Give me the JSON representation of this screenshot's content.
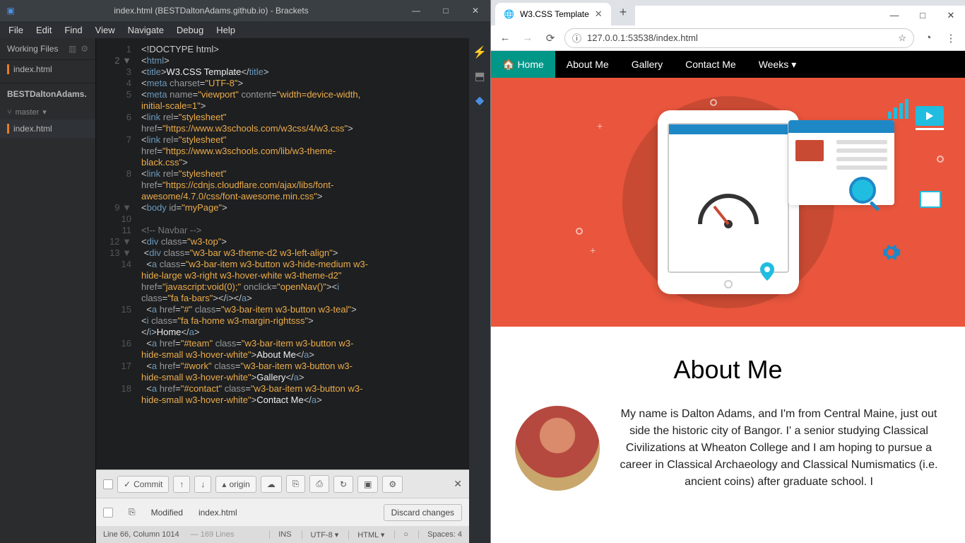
{
  "brackets": {
    "title": "index.html (BESTDaltonAdams.github.io) - Brackets",
    "menu": [
      "File",
      "Edit",
      "Find",
      "View",
      "Navigate",
      "Debug",
      "Help"
    ],
    "workingFiles": {
      "label": "Working Files",
      "items": [
        "index.html"
      ]
    },
    "project": {
      "name": "BESTDaltonAdams.",
      "branch": "master",
      "files": [
        "index.html"
      ]
    },
    "git": {
      "commit": "Commit",
      "origin": "origin",
      "modified": "Modified",
      "file": "index.html",
      "discard": "Discard changes"
    },
    "status": {
      "pos": "Line 66, Column 1014",
      "lines": "169 Lines",
      "ins": "INS",
      "enc": "UTF-8",
      "lang": "HTML",
      "spaces": "Spaces: 4"
    },
    "code": {
      "doctype": "<!DOCTYPE html>",
      "title_text": "W3.CSS Template",
      "charset": "UTF-8",
      "viewport": "width=device-width, initial-scale=1",
      "css1": "https://www.w3schools.com/w3css/4/w3.css",
      "css2": "https://www.w3schools.com/lib/w3-theme-black.css",
      "css3": "https://cdnjs.cloudflare.com/ajax/libs/font-awesome/4.7.0/css/font-awesome.min.css",
      "bodyid": "myPage",
      "comment": "<!-- Navbar -->",
      "cls_top": "w3-top",
      "cls_bar": "w3-bar w3-theme-d2 w3-left-align",
      "a1_class": "w3-bar-item w3-button w3-hide-medium w3-hide-large w3-right w3-hover-white w3-theme-d2",
      "a1_href": "javascript:void(0);",
      "a1_onclick": "openNav()",
      "a1_iclass": "fa fa-bars",
      "a2_href": "#",
      "a2_class": "w3-bar-item w3-button w3-teal",
      "a2_iclass": "fa fa-home w3-margin-rightsss",
      "a2_text": "Home",
      "a3_href": "#team",
      "a3_class": "w3-bar-item w3-button w3-hide-small w3-hover-white",
      "a3_text": "About Me",
      "a4_href": "#work",
      "a4_class": "w3-bar-item w3-button w3-hide-small w3-hover-white",
      "a4_text": "Gallery",
      "a5_href": "#contact",
      "a5_class": "w3-bar-item w3-button w3-hide-small w3-hover-white",
      "a5_text": "Contact Me"
    }
  },
  "browser": {
    "tabTitle": "W3.CSS Template",
    "url": "127.0.0.1:53538/index.html",
    "nav": {
      "home": "Home",
      "about": "About Me",
      "gallery": "Gallery",
      "contact": "Contact Me",
      "weeks": "Weeks"
    },
    "about": {
      "heading": "About Me",
      "text": "My name is Dalton Adams, and I'm from Central Maine, just out side the historic city of Bangor. I' a senior studying Classical Civilizations at Wheaton College and I am hoping to pursue a career in Classical Archaeology and Classical Numismatics (i.e. ancient coins) after graduate school. I"
    }
  }
}
